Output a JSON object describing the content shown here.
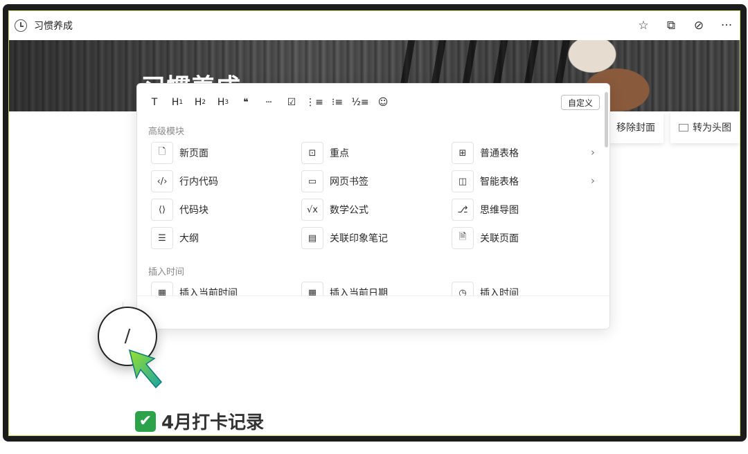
{
  "window": {
    "title": "习惯养成",
    "icon": "clock-icon"
  },
  "title_actions": [
    {
      "name": "star-icon",
      "glyph": "☆"
    },
    {
      "name": "open-external-icon",
      "glyph": "⧉"
    },
    {
      "name": "compass-icon",
      "glyph": "⊘"
    },
    {
      "name": "more-icon",
      "glyph": "···"
    }
  ],
  "cover": {
    "page_title": "习惯养成",
    "remove_cover": "移除封面",
    "to_header": "转为头图"
  },
  "menu": {
    "custom_label": "自定义",
    "format_buttons": [
      {
        "name": "text-format-icon",
        "glyph": "T"
      },
      {
        "name": "heading1-icon",
        "glyph": "H",
        "sub": "1"
      },
      {
        "name": "heading2-icon",
        "glyph": "H",
        "sub": "2"
      },
      {
        "name": "heading3-icon",
        "glyph": "H",
        "sub": "3"
      },
      {
        "name": "quote-icon",
        "glyph": "❝"
      },
      {
        "name": "divider-icon",
        "glyph": "┄"
      },
      {
        "name": "checkbox-icon",
        "glyph": "☑"
      },
      {
        "name": "checklist-icon",
        "glyph": "⋮≡"
      },
      {
        "name": "bullet-list-icon",
        "glyph": "⁝≡"
      },
      {
        "name": "numbered-list-icon",
        "glyph": "½≡"
      },
      {
        "name": "emoji-icon",
        "glyph": "☺"
      }
    ],
    "section_advanced": "高级模块",
    "advanced_items": [
      {
        "label": "新页面",
        "icon": "new-page-icon",
        "glyph": "🗋",
        "chevron": false
      },
      {
        "label": "重点",
        "icon": "highlight-icon",
        "glyph": "⊡",
        "chevron": false
      },
      {
        "label": "普通表格",
        "icon": "table-icon",
        "glyph": "⊞",
        "chevron": true
      },
      {
        "label": "行内代码",
        "icon": "inline-code-icon",
        "glyph": "‹/›",
        "chevron": false
      },
      {
        "label": "网页书签",
        "icon": "bookmark-icon",
        "glyph": "▭",
        "chevron": false
      },
      {
        "label": "智能表格",
        "icon": "smart-table-icon",
        "glyph": "◫",
        "chevron": true
      },
      {
        "label": "代码块",
        "icon": "code-block-icon",
        "glyph": "⟨⟩",
        "chevron": false
      },
      {
        "label": "数学公式",
        "icon": "math-formula-icon",
        "glyph": "√x",
        "chevron": false
      },
      {
        "label": "思维导图",
        "icon": "mindmap-icon",
        "glyph": "⎇",
        "chevron": false
      },
      {
        "label": "大纲",
        "icon": "outline-icon",
        "glyph": "☰",
        "chevron": false
      },
      {
        "label": "关联印象笔记",
        "icon": "linked-note-icon",
        "glyph": "▤",
        "chevron": false
      },
      {
        "label": "关联页面",
        "icon": "linked-page-icon",
        "glyph": "🗎",
        "chevron": false
      }
    ],
    "section_insert_time": "插入时间",
    "time_items": [
      {
        "label": "插入当前时间",
        "icon": "calendar-icon",
        "glyph": "▦"
      },
      {
        "label": "插入当前日期",
        "icon": "calendar-date-icon",
        "glyph": "▦"
      },
      {
        "label": "插入时间",
        "icon": "clock-icon",
        "glyph": "◷"
      }
    ],
    "chevron_glyph": "›"
  },
  "slash_key": "/",
  "heading": {
    "emoji": "✔",
    "text": "4月打卡记录"
  }
}
